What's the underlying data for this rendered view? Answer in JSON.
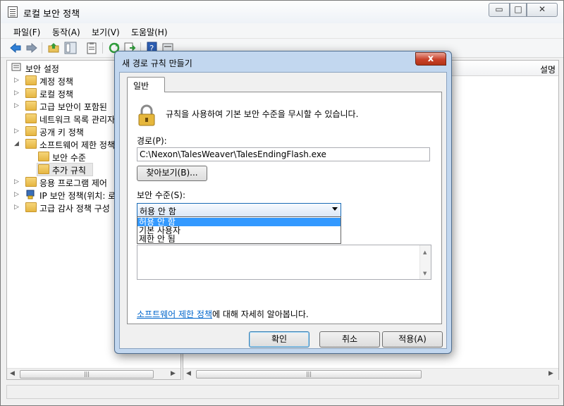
{
  "window": {
    "title": "로컬 보안 정책",
    "min_glyph": "▭",
    "max_glyph": "□",
    "close_glyph": "✕"
  },
  "menu": [
    "파일(F)",
    "동작(A)",
    "보기(V)",
    "도움말(H)"
  ],
  "tree": {
    "root": "보안 설정",
    "items": [
      {
        "label": "계정 정책"
      },
      {
        "label": "로컬 정책"
      },
      {
        "label": "고급 보안이 포함된"
      },
      {
        "label": "네트워크 목록 관리자"
      },
      {
        "label": "공개 키 정책"
      },
      {
        "label": "소프트웨어 제한 정책"
      },
      {
        "label": "보안 수준"
      },
      {
        "label": "추가 규칙"
      },
      {
        "label": "응용 프로그램 제어"
      },
      {
        "label": "IP 보안 정책(위치: 로"
      },
      {
        "label": "고급 감사 정책 구성"
      }
    ]
  },
  "list": {
    "col_description": "설명"
  },
  "dialog": {
    "title": "새 경로 규칙 만들기",
    "close_glyph": "x",
    "tab_label": "일반",
    "info_text": "규칙을 사용하여 기본 보안 수준을 무시할 수 있습니다.",
    "path_label": "경로(P):",
    "path_value": "C:\\Nexon\\TalesWeaver\\TalesEndingFlash.exe",
    "browse_label": "찾아보기(B)...",
    "level_label": "보안 수준(S):",
    "level_selected": "허용 안 함",
    "level_options": [
      "허용 안 함",
      "기본 사용자",
      "제한 안 됨"
    ],
    "learn_link": "소프트웨어 제한 정책",
    "learn_rest": "에 대해 자세히 알아봅니다.",
    "ok_label": "확인",
    "cancel_label": "취소",
    "apply_label": "적용(A)"
  },
  "colors": {
    "selection": "#3399ff",
    "link": "#0066cc",
    "dialog_frame": "#c2d7ef"
  }
}
